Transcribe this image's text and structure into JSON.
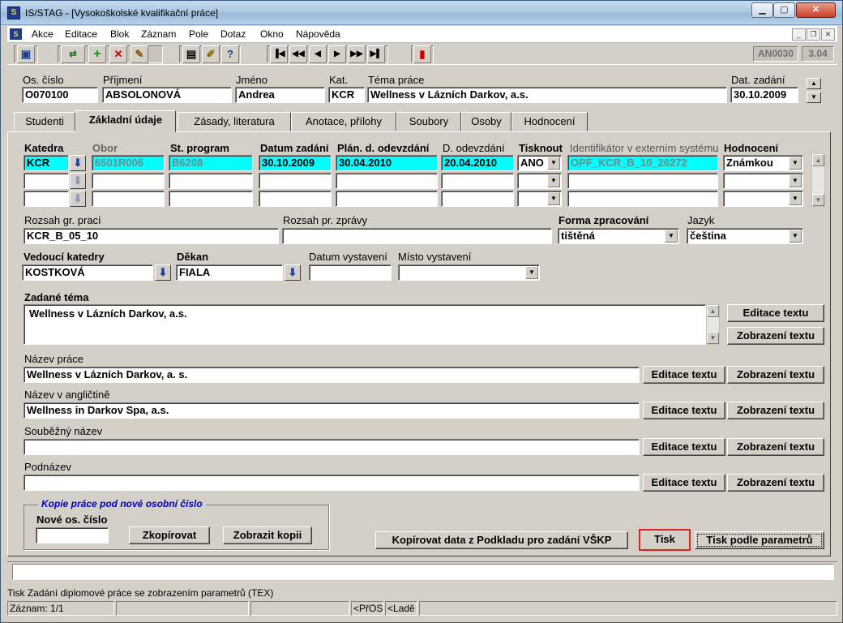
{
  "window": {
    "title": "IS/STAG - [Vysokoškolské kvalifikační práce]"
  },
  "menu": [
    "Akce",
    "Editace",
    "Blok",
    "Záznam",
    "Pole",
    "Dotaz",
    "Okno",
    "Nápověda"
  ],
  "toolbar": {
    "form_id": "AN0030",
    "version": "3.04"
  },
  "header": {
    "os_cislo": {
      "label": "Os. číslo",
      "value": "O070100"
    },
    "prijmeni": {
      "label": "Příjmení",
      "value": "ABSOLONOVÁ"
    },
    "jmeno": {
      "label": "Jméno",
      "value": "Andrea"
    },
    "kat": {
      "label": "Kat.",
      "value": "KCR"
    },
    "tema": {
      "label": "Téma práce",
      "value": "Wellness v Lázních Darkov, a.s."
    },
    "dat_zadani": {
      "label": "Dat. zadání",
      "value": "30.10.2009"
    }
  },
  "tabs": [
    "Studenti",
    "Základní údaje",
    "Zásady, literatura",
    "Anotace, přílohy",
    "Soubory",
    "Osoby",
    "Hodnocení"
  ],
  "grid": {
    "headers": {
      "katedra": "Katedra",
      "obor": "Obor",
      "program": "St. program",
      "datum_zadani": "Datum zadání",
      "plan_odevzdani": "Plán. d. odevzdání",
      "odevzdani": "D. odevzdání",
      "tisknout": "Tisknout",
      "identifikator": "Identifikátor v externím systému",
      "hodnoceni": "Hodnocení"
    },
    "row": {
      "katedra": "KCR",
      "obor": "6501R006",
      "program": "B6208",
      "datum_zadani": "30.10.2009",
      "plan_odevzdani": "30.04.2010",
      "odevzdani": "20.04.2010",
      "tisknout": "ANO",
      "identifikator": "OPF_KCR_B_10_26272",
      "hodnoceni": "Známkou"
    }
  },
  "rozsah_prac": {
    "label": "Rozsah gr. prací",
    "value": "KCR_B_05_10"
  },
  "rozsah_zpravy": {
    "label": "Rozsah pr. zprávy",
    "value": ""
  },
  "forma": {
    "label": "Forma zpracování",
    "value": "tištěná"
  },
  "jazyk": {
    "label": "Jazyk",
    "value": "čeština"
  },
  "vedouci": {
    "label": "Vedoucí katedry",
    "value": "KOSTKOVÁ"
  },
  "dekan": {
    "label": "Děkan",
    "value": "FIALA"
  },
  "datum_vystaveni": {
    "label": "Datum vystavení",
    "value": ""
  },
  "misto_vystaveni": {
    "label": "Místo vystavení",
    "value": ""
  },
  "zadane_tema": {
    "label": "Zadané téma",
    "value": "Wellness v Lázních Darkov, a.s."
  },
  "nazev_prace": {
    "label": "Název práce",
    "value": "Wellness v Lázních Darkov, a. s."
  },
  "nazev_en": {
    "label": "Název v angličtině",
    "value": "Wellness in Darkov Spa, a.s."
  },
  "soubezny": {
    "label": "Souběžný název",
    "value": ""
  },
  "podnazev": {
    "label": "Podnázev",
    "value": ""
  },
  "buttons": {
    "editace": "Editace textu",
    "zobrazeni": "Zobrazení textu",
    "zkopirovat": "Zkopírovat",
    "zobrazit_kopii": "Zobrazit kopii",
    "kopirovat_podklad": "Kopírovat data z Podkladu pro zadání VŠKP",
    "tisk": "Tisk",
    "tisk_parametry": "Tisk podle parametrů"
  },
  "kopie": {
    "title": "Kopie práce pod nové osobní číslo",
    "label": "Nové os. číslo"
  },
  "hint": "Tisk Zadání diplomové práce se zobrazením parametrů (TEX)",
  "status": {
    "zaznam": "Záznam: 1/1",
    "pros": "<PřOS",
    "lade": "<Ladě"
  }
}
